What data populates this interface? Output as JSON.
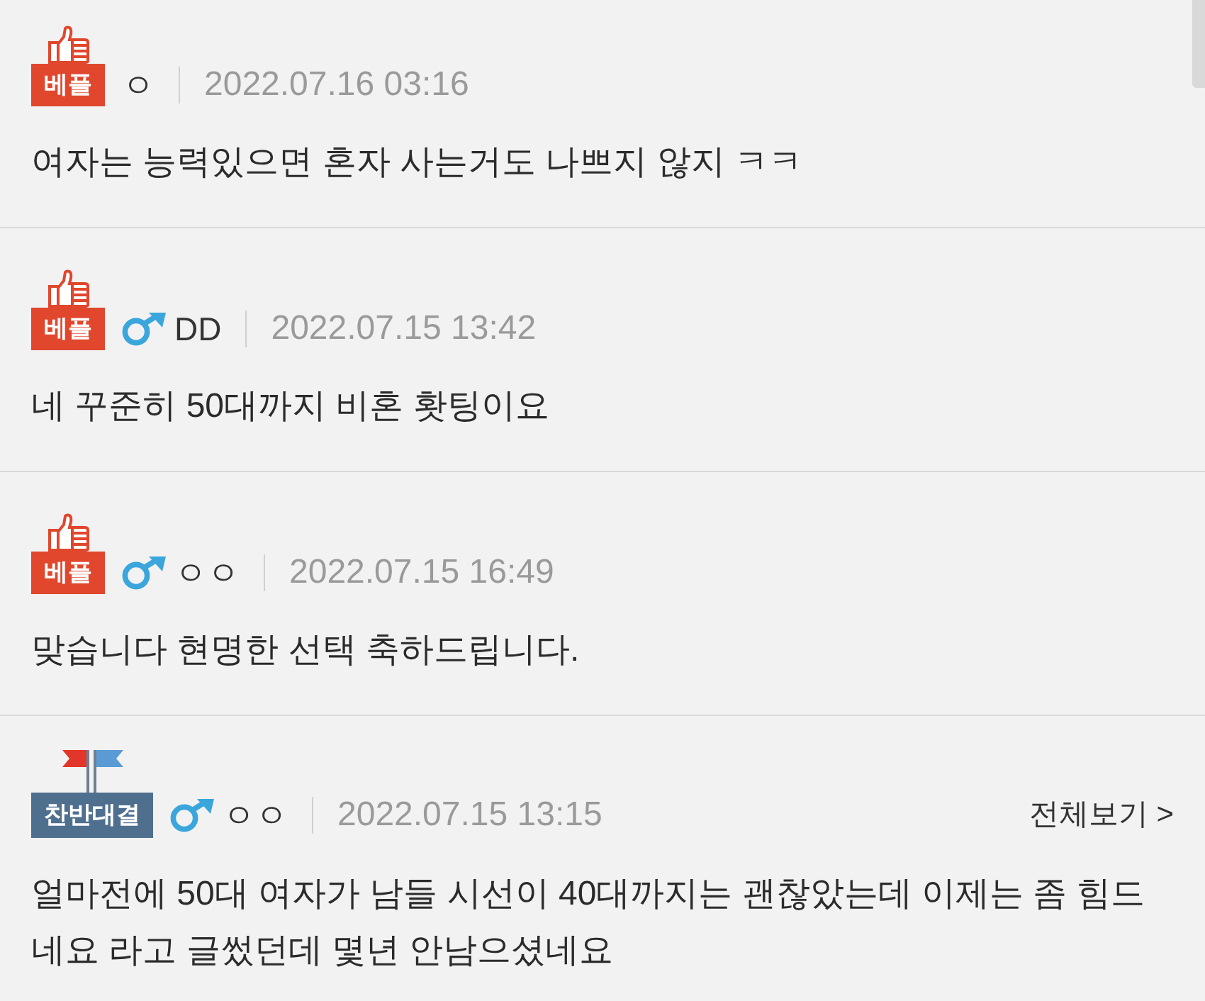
{
  "comments": [
    {
      "badge": {
        "kind": "best",
        "label": "베플"
      },
      "male": false,
      "author": "ㅇ",
      "date": "2022.07.16 03:16",
      "text": "여자는 능력있으면 혼자 사는거도 나쁘지 않지 ㅋㅋ"
    },
    {
      "badge": {
        "kind": "best",
        "label": "베플"
      },
      "male": true,
      "author": "DD",
      "date": "2022.07.15 13:42",
      "text": "네 꾸준히 50대까지 비혼 홧팅이요"
    },
    {
      "badge": {
        "kind": "best",
        "label": "베플"
      },
      "male": true,
      "author": "ㅇㅇ",
      "date": "2022.07.15 16:49",
      "text": "맞습니다 현명한 선택 축하드립니다."
    },
    {
      "badge": {
        "kind": "debate",
        "label": "찬반대결"
      },
      "male": true,
      "author": "ㅇㅇ",
      "date": "2022.07.15 13:15",
      "more_link": "전체보기 >",
      "text": "얼마전에 50대 여자가 남들 시선이 40대까지는 괜찮았는데 이제는 좀 힘드네요 라고 글썼던데 몇년 안남으셨네요"
    }
  ]
}
